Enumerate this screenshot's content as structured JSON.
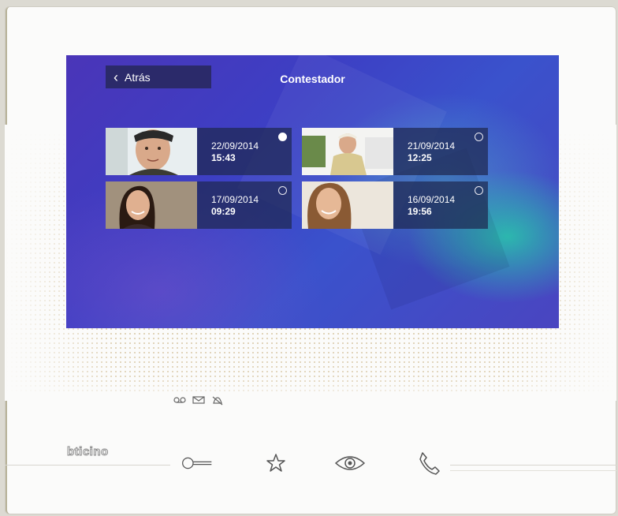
{
  "header": {
    "back_label": "Atrás",
    "title": "Contestador"
  },
  "messages": [
    {
      "date": "22/09/2014",
      "time": "15:43",
      "selected": true
    },
    {
      "date": "21/09/2014",
      "time": "12:25",
      "selected": false
    },
    {
      "date": "17/09/2014",
      "time": "09:29",
      "selected": false
    },
    {
      "date": "16/09/2014",
      "time": "19:56",
      "selected": false
    }
  ],
  "brand": {
    "logo_text": "bticino"
  },
  "status_icons": [
    "voicemail-icon",
    "envelope-icon",
    "bell-muted-icon"
  ],
  "buttons": [
    "key-icon",
    "star-icon",
    "eye-icon",
    "phone-icon"
  ],
  "colors": {
    "screen_accent": "#3d3fc4",
    "back_button_bg": "#2b2a6a",
    "teal_glow": "#28c8aa"
  }
}
